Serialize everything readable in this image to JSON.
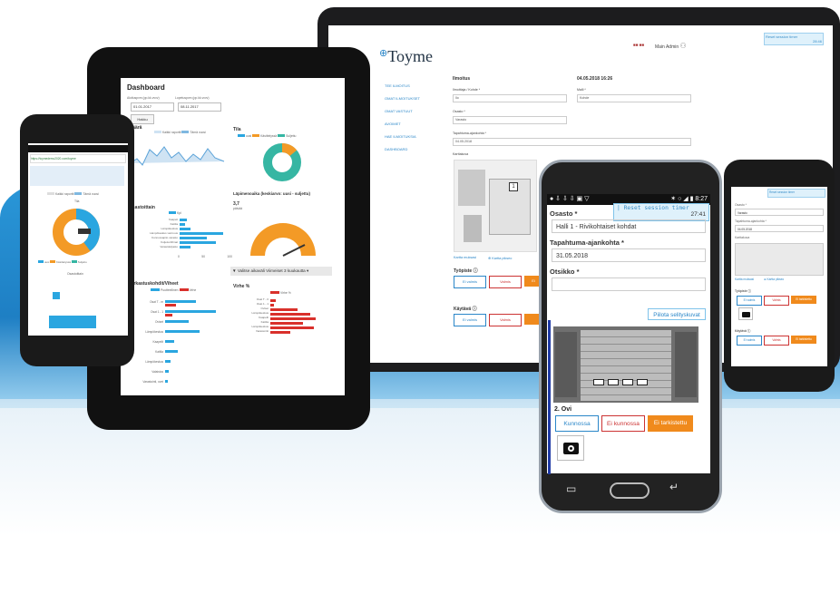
{
  "laptop": {
    "brand": "Toyme",
    "header_user": "Main Admin",
    "header_lang": "■■ ■■",
    "timer_small": "Reset session timer",
    "timer_small_value": "28:46",
    "nav": [
      "TEE ILMOITUS",
      "OMAT ILMOITUKSET",
      "OMAT VASTUUT",
      "AVOIMET",
      "HAE ILMOITUKSIA",
      "DASHBOARD"
    ],
    "form_title": "Ilmoitus",
    "form_date": "04.05.2018 16:26",
    "fields": [
      {
        "label": "Ilmoittaja / Kohde *",
        "value": "Ilo"
      },
      {
        "label": "Malli *",
        "value": "Kohde"
      },
      {
        "label": "Osasto *",
        "value": "Varasto"
      },
      {
        "label": "Tapahtuma-ajankohta *",
        "value": "04.05.2018"
      },
      {
        "label": "Karttakuva",
        "value": ""
      }
    ],
    "map_buttons": [
      "Kartta muksasi",
      "⊕ Kartta pikseo"
    ],
    "section1": "Työpiste ⓘ",
    "section2": "Käytävä ⓘ",
    "status_buttons": [
      "Ei valmis",
      "Valmis",
      "Ei tarkistettu"
    ],
    "map_marker": "1"
  },
  "tablet": {
    "title": "Dashboard",
    "date_label_from": "Aloituspvm (pp.kk.vvvv)",
    "date_label_to": "Lopetuspvm (pp.kk.vvvv)",
    "date_from": "01.01.2017",
    "date_to": "08.11.2017",
    "search_button": "Hakku",
    "chart1_title": "Määrä",
    "chart1_legend": [
      "Kaikki raportit",
      "Tämä vuosi"
    ],
    "chart2_title": "Tila",
    "chart2_legend": [
      "uusi",
      "Käsittelyssä",
      "Suljettu"
    ],
    "chart3_title": "Osastoittain",
    "chart3_legend": "Kpl",
    "chart3_categories": [
      "Kaapeli",
      "Kattila",
      "Lämpökeskus",
      "Lämpökeskus varmuus",
      "Kunnossapito varasto",
      "Kuljetushihnat",
      "Varastokirjasto"
    ],
    "chart4_title": "Läpimenoaika (keskiarvo: uusi - suljettu)",
    "chart4_value": "3,7",
    "chart4_unit": "päivää",
    "chart5_title": "Tarkastuskohdit/Viheet",
    "chart5_legend": [
      "Puutteellinen",
      "Virhe"
    ],
    "chart5_categories": [
      "Osat T - m",
      "Osat 1 - 1",
      "Oviset",
      "Lämpökeskus",
      "Kaapelit",
      "Kattila",
      "Lämpökeskus",
      "Valaistus",
      "Varastointi, ovet"
    ],
    "chart6_title": "Virhe %",
    "chart6_legend": "Virhe %",
    "chart6_categories": [
      "Osat T - 0",
      "Osat 1 - 1",
      "Oviset",
      "Lämpökeskus",
      "Kaapelit",
      "Kattila",
      "Lämpökeskus",
      "Varastointi"
    ],
    "select_label": "▼ Valitse aikaväli",
    "select_value": "Viimeiset 3 kuukautta ▾",
    "axis_ticks": [
      "0",
      "50",
      "100"
    ]
  },
  "phone1": {
    "url": "https://toymedemo2020.com/toyme",
    "chart_title": "Tila",
    "legend": [
      "Kaikki raportit",
      "Tämä vuosi"
    ],
    "bar_title": "Osastoittain",
    "pie_legend": [
      "uusi",
      "Käsittelyssä",
      "Suljettu"
    ]
  },
  "phone2": {
    "status_left": "● ⇩ ⇩ ⇩ ▣ ▽",
    "status_right": "✶ ○ ◢ ▮ 8:27",
    "timer_label": "| Reset session timer",
    "timer_value": "27:41",
    "osasto_label": "Osasto *",
    "osasto_value": "Halli 1 - Rivikohtaiset kohdat",
    "date_label": "Tapahtuma-ajankohta *",
    "date_value": "31.05.2018",
    "title_label": "Otsikko *",
    "title_value": "",
    "hide_images": "Piilota selityskuvat",
    "item_title": "2. Ovi",
    "buttons": [
      "Kunnossa",
      "Ei kunnossa",
      "Ei tarkistettu"
    ]
  },
  "phone3": {
    "timer": "Reset session timer",
    "labels": [
      "Osasto *",
      "Tapahtuma-ajankohta *",
      "Karttakuva",
      "Työpiste ⓘ",
      "Käytävä ⓘ"
    ],
    "values": [
      "Varasto",
      "04.05.2018"
    ],
    "map_buttons": [
      "Kartta muksasi",
      "⊕ Kartta pikseo"
    ],
    "buttons": [
      "Ei valmis",
      "Valmis",
      "Ei tarkistettu"
    ]
  }
}
